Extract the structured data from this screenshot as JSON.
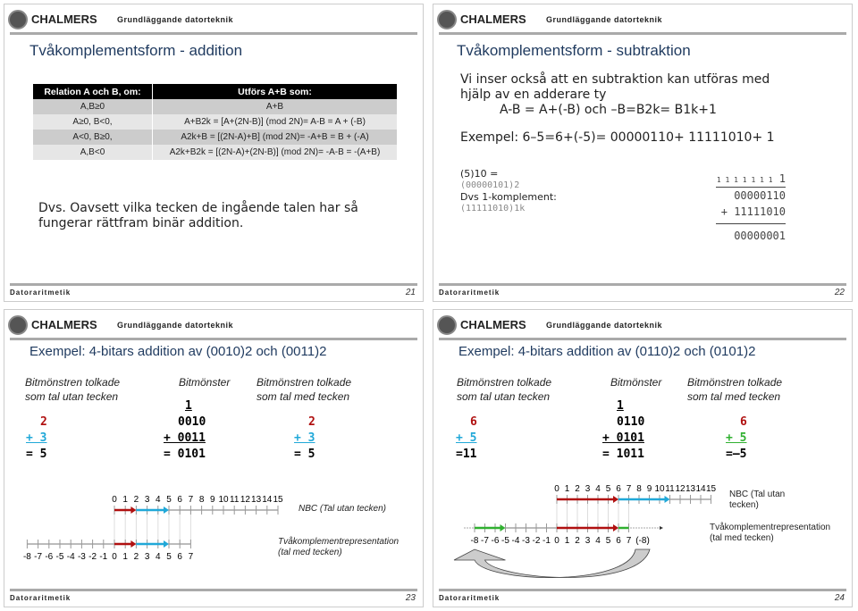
{
  "header": {
    "brand": "CHALMERS",
    "course": "Grundläggande datorteknik"
  },
  "footer": {
    "label": "Datoraritmetik"
  },
  "slides": [
    {
      "page": "21",
      "title": "Tvåkomplementsform - addition",
      "table": {
        "headers": [
          "Relation A och B, om:",
          "Utförs A+B som:"
        ],
        "rows": [
          [
            "A,B≥0",
            "A+B"
          ],
          [
            "A≥0, B<0,",
            "A+B2k = [A+(2N-B)] (mod 2N)= A-B = A + (-B)"
          ],
          [
            "A<0, B≥0,",
            "A2k+B = [(2N-A)+B] (mod 2N)= -A+B = B + (-A)"
          ],
          [
            "A,B<0",
            "A2k+B2k = [(2N-A)+(2N-B)] (mod 2N)= -A-B = -(A+B)"
          ]
        ]
      },
      "note_line1": "Dvs. Oavsett vilka tecken de ingående talen har så",
      "note_line2": "fungerar rättfram binär addition."
    },
    {
      "page": "22",
      "title": "Tvåkomplementsform - subtraktion",
      "line1": "Vi inser också att en subtraktion kan utföras med",
      "line2": "hjälp av en adderare ty",
      "line3": "A-B = A+(-B) och –B=B2k= B1k+1",
      "line4": "Exempel: 6–5=6+(-5)= 00000110+ 11111010+ 1",
      "left1": "(5)10 =",
      "left2": "(00000101)2",
      "left3": "Dvs 1-komplement:",
      "left4": "(11111010)1k",
      "carry": "1 1 1 1 1 1 1",
      "carry_in": "1",
      "op1": "00000110",
      "op2": "+ 11111010",
      "result": "00000001"
    },
    {
      "page": "23",
      "title": "Exempel: 4-bitars addition av (0010)2 och (0011)2",
      "col_unsigned": [
        "Bitmönstren tolkade",
        "som tal utan tecken"
      ],
      "col_bits": "Bitmönster",
      "col_signed": [
        "Bitmönstren tolkade",
        "som tal med tecken"
      ],
      "unsigned": [
        "2",
        "+ 3",
        "= 5"
      ],
      "bits": [
        "1",
        "0010",
        "+ 0011",
        "= 0101"
      ],
      "signed": [
        "2",
        "+ 3",
        "= 5"
      ],
      "nbc_label": "NBC (Tal utan tecken)",
      "twos_label": [
        "Tvåkomplementrepresentation",
        "(tal med tecken)"
      ],
      "nbc_ticks": [
        "0",
        "1",
        "2",
        "3",
        "4",
        "5",
        "6",
        "7",
        "8",
        "9",
        "10",
        "11",
        "12",
        "13",
        "14",
        "15"
      ],
      "twos_ticks": [
        "-8",
        "-7",
        "-6",
        "-5",
        "-4",
        "-3",
        "-2",
        "-1",
        "0",
        "1",
        "2",
        "3",
        "4",
        "5",
        "6",
        "7"
      ]
    },
    {
      "page": "24",
      "title": "Exempel: 4-bitars addition av (0110)2 och (0101)2",
      "col_unsigned": [
        "Bitmönstren tolkade",
        "som tal utan tecken"
      ],
      "col_bits": "Bitmönster",
      "col_signed": [
        "Bitmönstren tolkade",
        "som tal med tecken"
      ],
      "unsigned": [
        "6",
        "+ 5",
        "=11"
      ],
      "bits": [
        "1",
        "0110",
        "+ 0101",
        "= 1011"
      ],
      "signed": [
        "6",
        "+ 5",
        "=–5"
      ],
      "nbc_label": [
        "NBC (Tal utan",
        "tecken)"
      ],
      "twos_label": [
        "Tvåkomplementrepresentation",
        "(tal med tecken)"
      ],
      "nbc_ticks": [
        "0",
        "1",
        "2",
        "3",
        "4",
        "5",
        "6",
        "7",
        "8",
        "9",
        "10",
        "11",
        "12",
        "13",
        "14",
        "15"
      ],
      "twos_ticks": [
        "-8",
        "-7",
        "-6",
        "-5",
        "-4",
        "-3",
        "-2",
        "-1",
        "0",
        "1",
        "2",
        "3",
        "4",
        "5",
        "6",
        "7",
        "(-8)"
      ]
    }
  ],
  "colors": {
    "title": "#1f3a5f",
    "first_operand": "#b01010",
    "second_unsigned": "#20a8d8",
    "second_signed": "#30b030"
  }
}
